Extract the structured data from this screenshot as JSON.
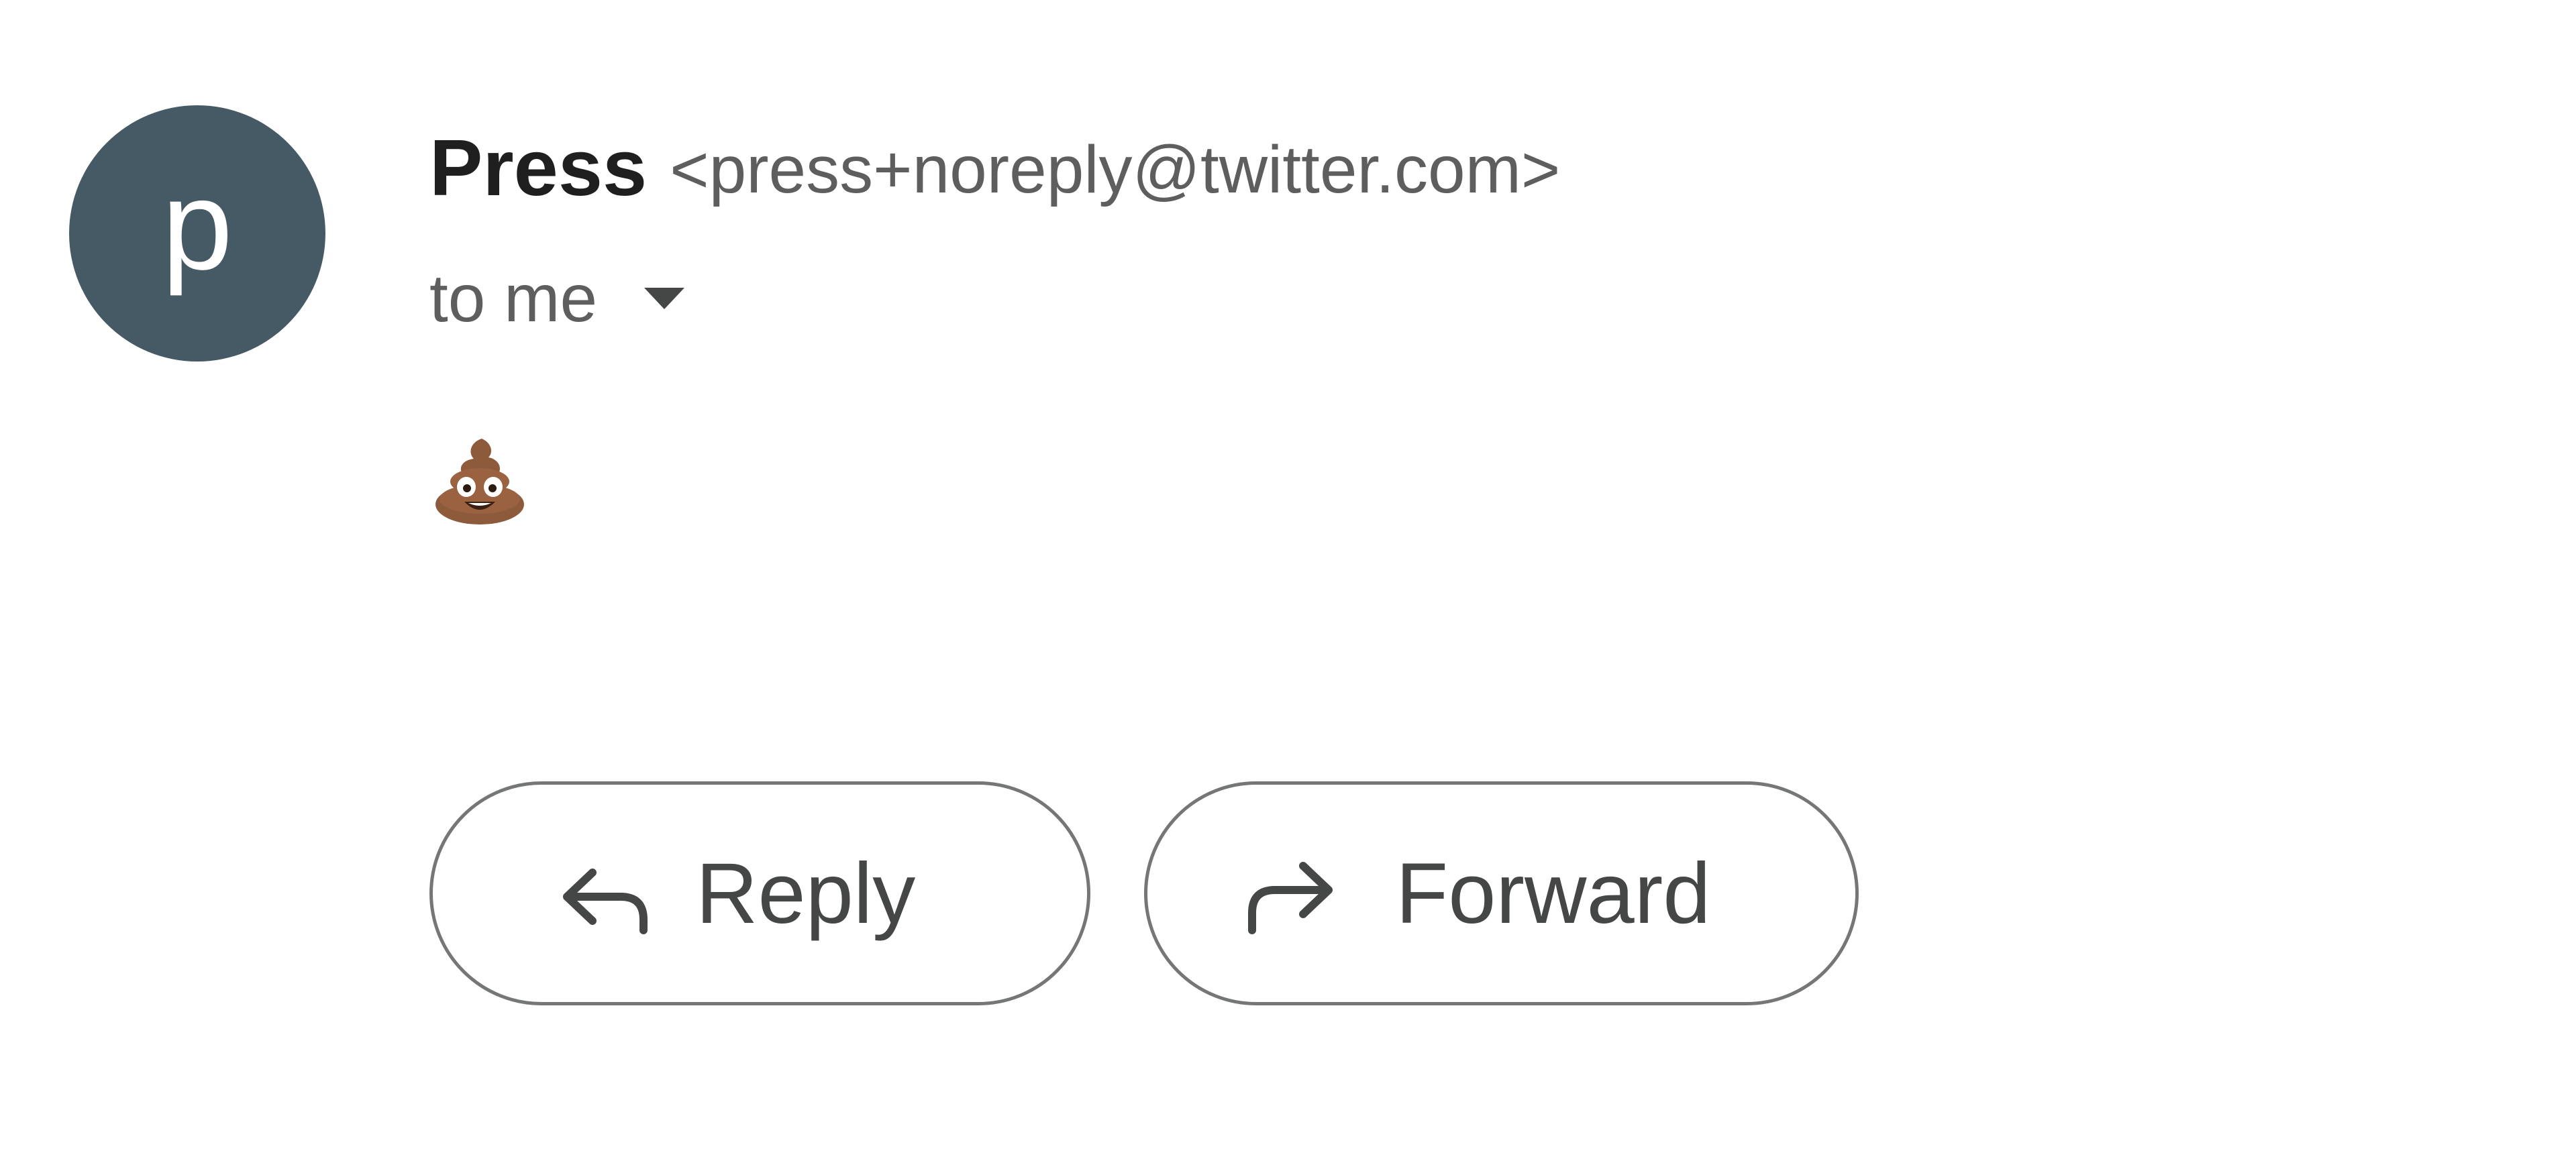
{
  "message": {
    "avatar": {
      "letter": "p",
      "color": "#455a64"
    },
    "sender": {
      "name": "Press",
      "email": "<press+noreply@twitter.com>"
    },
    "recipient": {
      "label": "to me",
      "toggle_icon": "caret-down-icon"
    },
    "body": {
      "emoji": "💩",
      "emoji_name": "pile-of-poo-icon"
    },
    "actions": {
      "reply_label": "Reply",
      "reply_icon": "reply-arrow-icon",
      "forward_label": "Forward",
      "forward_icon": "forward-arrow-icon"
    }
  }
}
